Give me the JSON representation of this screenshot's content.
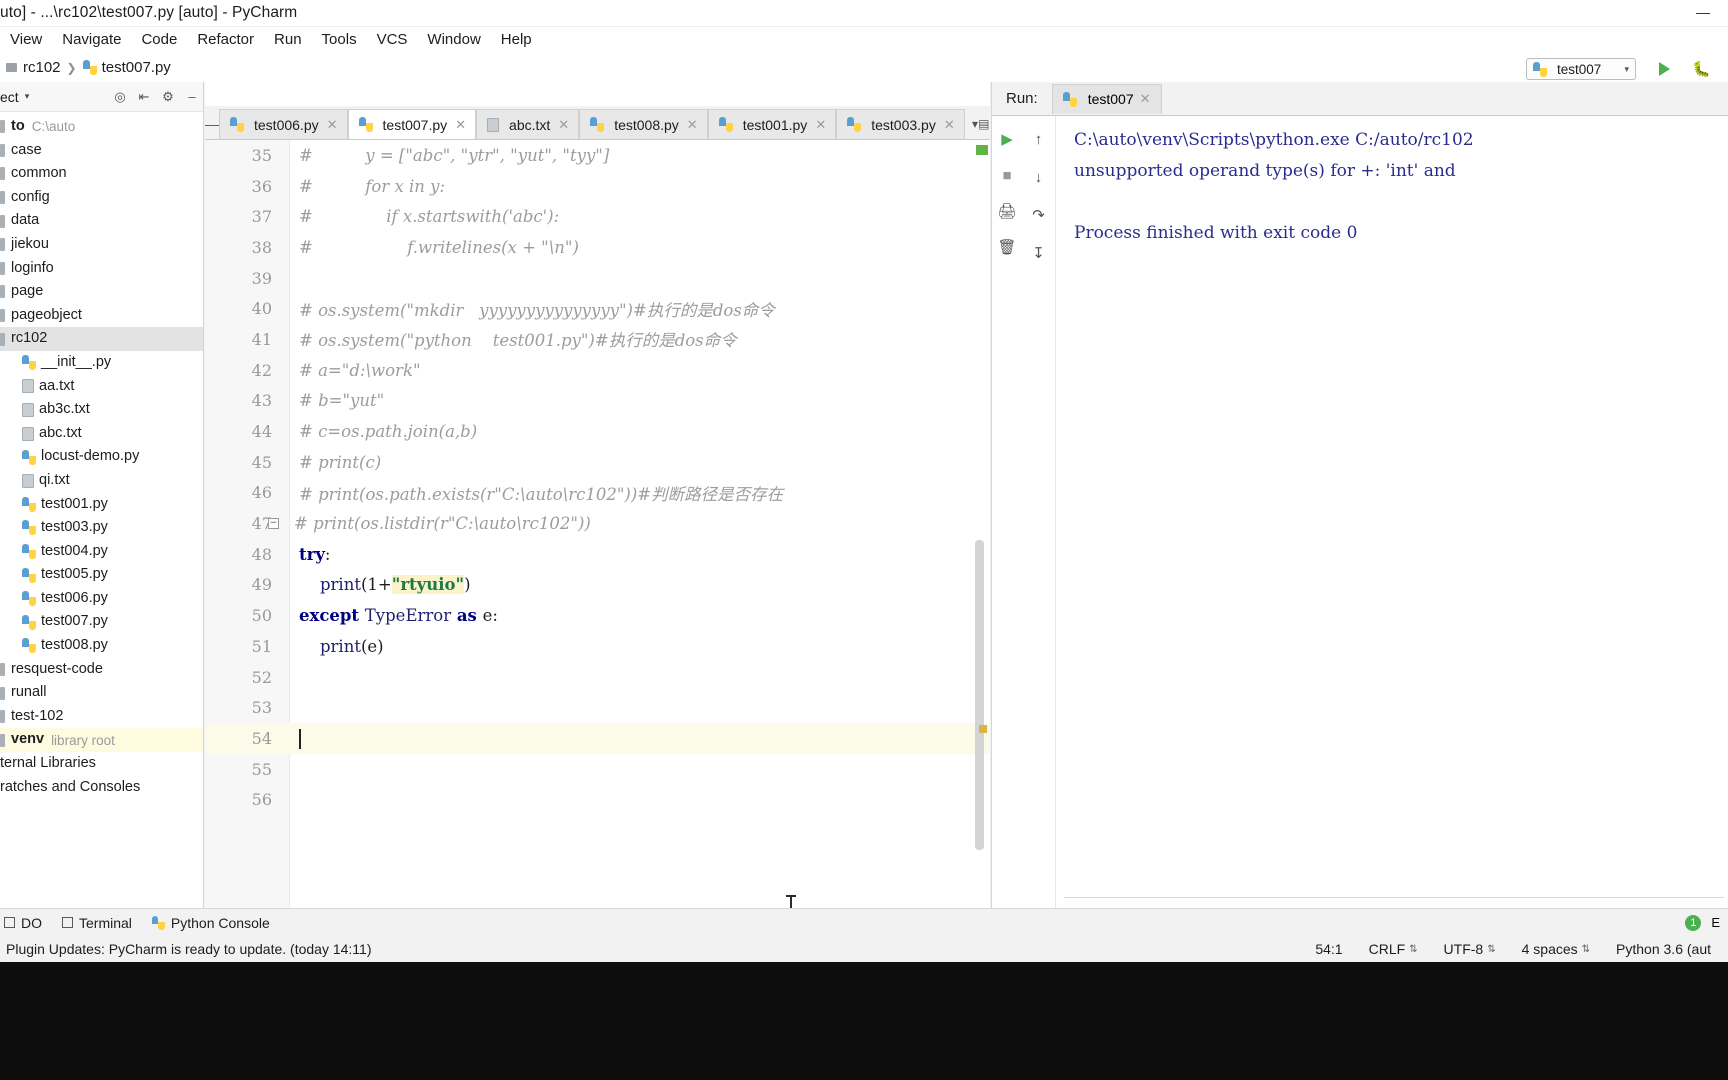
{
  "window": {
    "title": "uto] - ...\\rc102\\test007.py [auto] - PyCharm",
    "minimize_label": "minimize",
    "menus": [
      "View",
      "Navigate",
      "Code",
      "Refactor",
      "Run",
      "Tools",
      "VCS",
      "Window",
      "Help"
    ]
  },
  "breadcrumb": {
    "folder": "rc102",
    "file": "test007.py"
  },
  "run_config": {
    "name": "test007",
    "caret": "▾",
    "run_button": "run",
    "debug_button": "debug"
  },
  "sidebar": {
    "panel_label": "ect",
    "panel_caret": "▾",
    "icons": [
      "target-icon",
      "collapse-icon",
      "settings-icon",
      "hide-icon"
    ],
    "root": {
      "label": "to",
      "path": "C:\\auto"
    },
    "items": [
      {
        "label": "case",
        "type": "folder",
        "indent": 0
      },
      {
        "label": "common",
        "type": "folder",
        "indent": 0
      },
      {
        "label": "config",
        "type": "folder",
        "indent": 0
      },
      {
        "label": "data",
        "type": "folder",
        "indent": 0
      },
      {
        "label": "jiekou",
        "type": "folder",
        "indent": 0
      },
      {
        "label": "loginfo",
        "type": "folder",
        "indent": 0
      },
      {
        "label": "page",
        "type": "folder",
        "indent": 0
      },
      {
        "label": "pageobject",
        "type": "folder",
        "indent": 0
      },
      {
        "label": "rc102",
        "type": "folder",
        "indent": 0,
        "state": "selected"
      },
      {
        "label": "__init__.py",
        "type": "python",
        "indent": 1
      },
      {
        "label": "aa.txt",
        "type": "text",
        "indent": 1
      },
      {
        "label": "ab3c.txt",
        "type": "text",
        "indent": 1
      },
      {
        "label": "abc.txt",
        "type": "text",
        "indent": 1
      },
      {
        "label": "locust-demo.py",
        "type": "python",
        "indent": 1
      },
      {
        "label": "qi.txt",
        "type": "text",
        "indent": 1
      },
      {
        "label": "test001.py",
        "type": "python",
        "indent": 1
      },
      {
        "label": "test003.py",
        "type": "python",
        "indent": 1
      },
      {
        "label": "test004.py",
        "type": "python",
        "indent": 1
      },
      {
        "label": "test005.py",
        "type": "python",
        "indent": 1
      },
      {
        "label": "test006.py",
        "type": "python",
        "indent": 1
      },
      {
        "label": "test007.py",
        "type": "python",
        "indent": 1
      },
      {
        "label": "test008.py",
        "type": "python",
        "indent": 1
      },
      {
        "label": "resquest-code",
        "type": "folder",
        "indent": 0
      },
      {
        "label": "runall",
        "type": "folder",
        "indent": 0
      },
      {
        "label": "test-102",
        "type": "folder",
        "indent": 0
      },
      {
        "label": "venv",
        "type": "folder",
        "indent": 0,
        "state": "highlight",
        "bold": true,
        "suffix": "library root"
      },
      {
        "label": "ternal Libraries",
        "type": "plain",
        "indent": 0
      },
      {
        "label": "ratches and Consoles",
        "type": "plain",
        "indent": 0
      }
    ]
  },
  "editor": {
    "tabs": [
      {
        "label": "test006.py",
        "type": "python",
        "active": false
      },
      {
        "label": "test007.py",
        "type": "python",
        "active": true
      },
      {
        "label": "abc.txt",
        "type": "text",
        "active": false
      },
      {
        "label": "test008.py",
        "type": "python",
        "active": false
      },
      {
        "label": "test001.py",
        "type": "python",
        "active": false
      },
      {
        "label": "test003.py",
        "type": "python",
        "active": false
      }
    ],
    "tab_overflow": "▾▤ 1",
    "minus_label": "—",
    "lines": [
      {
        "no": "35",
        "segments": [
          {
            "t": "#          y = [\"abc\", \"ytr\", \"yut\", \"tyy\"]",
            "c": "cmt"
          }
        ]
      },
      {
        "no": "36",
        "segments": [
          {
            "t": "#          for x in y:",
            "c": "cmt"
          }
        ]
      },
      {
        "no": "37",
        "segments": [
          {
            "t": "#              if x.startswith('abc'):",
            "c": "cmt"
          }
        ]
      },
      {
        "no": "38",
        "segments": [
          {
            "t": "#                  f.writelines(x + \"\\n\")",
            "c": "cmt"
          }
        ]
      },
      {
        "no": "39",
        "segments": []
      },
      {
        "no": "40",
        "segments": [
          {
            "t": "# os.system(\"mkdir   yyyyyyyyyyyyyyy\")#执行的是dos命令",
            "c": "cmt"
          }
        ]
      },
      {
        "no": "41",
        "segments": [
          {
            "t": "# os.system(\"python    test001.py\")#执行的是dos命令",
            "c": "cmt"
          }
        ]
      },
      {
        "no": "42",
        "segments": [
          {
            "t": "# a=\"d:\\work\"",
            "c": "cmt"
          }
        ]
      },
      {
        "no": "43",
        "segments": [
          {
            "t": "# b=\"yut\"",
            "c": "cmt"
          }
        ]
      },
      {
        "no": "44",
        "segments": [
          {
            "t": "# c=os.path.join(a,b)",
            "c": "cmt"
          }
        ]
      },
      {
        "no": "45",
        "segments": [
          {
            "t": "# print(c)",
            "c": "cmt"
          }
        ]
      },
      {
        "no": "46",
        "segments": [
          {
            "t": "# print(os.path.exists(r\"C:\\auto\\rc102\"))#判断路径是否存在",
            "c": "cmt"
          }
        ]
      },
      {
        "no": "47",
        "segments": [
          {
            "t": "# print(os.listdir(r\"C:\\auto\\rc102\"))",
            "c": "cmt"
          }
        ],
        "fold": "−"
      },
      {
        "no": "48",
        "segments": [
          {
            "t": "try",
            "c": "kw"
          },
          {
            "t": ":",
            "c": "pl"
          }
        ]
      },
      {
        "no": "49",
        "segments": [
          {
            "t": "    print",
            "c": "fn"
          },
          {
            "t": "(1+",
            "c": "pl"
          },
          {
            "t": "\"rtyuio\"",
            "c": "str hl"
          },
          {
            "t": ")",
            "c": "pl"
          }
        ]
      },
      {
        "no": "50",
        "segments": [
          {
            "t": "except ",
            "c": "kw"
          },
          {
            "t": "TypeError",
            "c": "cls"
          },
          {
            "t": " as ",
            "c": "kw"
          },
          {
            "t": "e:",
            "c": "pl"
          }
        ]
      },
      {
        "no": "51",
        "segments": [
          {
            "t": "    print",
            "c": "fn"
          },
          {
            "t": "(e)",
            "c": "pl"
          }
        ]
      },
      {
        "no": "52",
        "segments": []
      },
      {
        "no": "53",
        "segments": []
      },
      {
        "no": "54",
        "segments": [],
        "cursor": true
      },
      {
        "no": "55",
        "segments": []
      },
      {
        "no": "56",
        "segments": []
      }
    ]
  },
  "run_panel": {
    "title": "Run:",
    "tab_label": "test007",
    "tools_left": [
      "run-icon",
      "stop-icon",
      "print-icon",
      "trash-icon"
    ],
    "tools_right": [
      "up-arrow-icon",
      "down-arrow-icon",
      "soft-wrap-icon",
      "scroll-to-end-icon"
    ],
    "console_lines": [
      "C:\\auto\\venv\\Scripts\\python.exe C:/auto/rc102",
      "unsupported operand type(s) for +: 'int' and",
      "",
      "Process finished with exit code 0"
    ]
  },
  "bottom_bar": {
    "items": [
      {
        "label": "DO",
        "icon": "todo-icon"
      },
      {
        "label": "Terminal",
        "icon": "terminal-icon"
      },
      {
        "label": "Python Console",
        "icon": "python-icon"
      }
    ],
    "right_badge": "1",
    "right_label": "E"
  },
  "status_bar": {
    "message": "Plugin Updates: PyCharm is ready to update. (today 14:11)",
    "caret_position": "54:1",
    "line_separator": "CRLF",
    "encoding": "UTF-8",
    "indent": "4 spaces",
    "interpreter": "Python 3.6 (aut"
  }
}
